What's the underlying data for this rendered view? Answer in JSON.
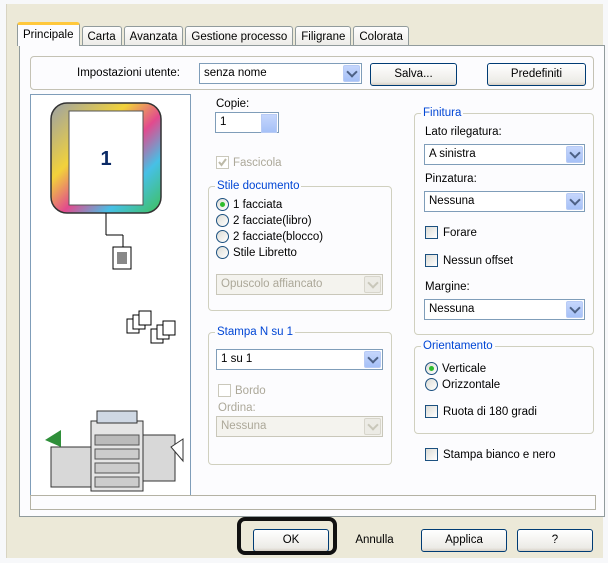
{
  "tabs": [
    "Principale",
    "Carta",
    "Avanzata",
    "Gestione processo",
    "Filigrane",
    "Colorata"
  ],
  "user_settings": {
    "label": "Impostazioni utente:",
    "value": "senza nome",
    "save_button": "Salva...",
    "defaults_button": "Predefiniti"
  },
  "preview": {
    "page_number": "1"
  },
  "copies": {
    "label": "Copie:",
    "value": "1",
    "collate_label": "Fascicola",
    "collate_checked": true
  },
  "document_style": {
    "legend": "Stile documento",
    "options": [
      "1 facciata",
      "2 facciate(libro)",
      "2 facciate(blocco)",
      "Stile Libretto"
    ],
    "selected": "1 facciata",
    "booklet_value": "Opuscolo affiancato"
  },
  "n_up": {
    "legend": "Stampa N su 1",
    "value": "1 su 1",
    "border_label": "Bordo",
    "order_label": "Ordina:",
    "order_value": "Nessuna"
  },
  "finishing": {
    "legend": "Finitura",
    "binding_label": "Lato rilegatura:",
    "binding_value": "A sinistra",
    "staple_label": "Pinzatura:",
    "staple_value": "Nessuna",
    "punch_label": "Forare",
    "offset_label": "Nessun offset",
    "margin_label": "Margine:",
    "margin_value": "Nessuna"
  },
  "orientation": {
    "legend": "Orientamento",
    "options": [
      "Verticale",
      "Orizzontale"
    ],
    "selected": "Verticale",
    "rotate_label": "Ruota di 180 gradi"
  },
  "bw_label": "Stampa bianco e nero",
  "footer": {
    "ok": "OK",
    "cancel": "Annulla",
    "apply": "Applica",
    "help": "?"
  }
}
